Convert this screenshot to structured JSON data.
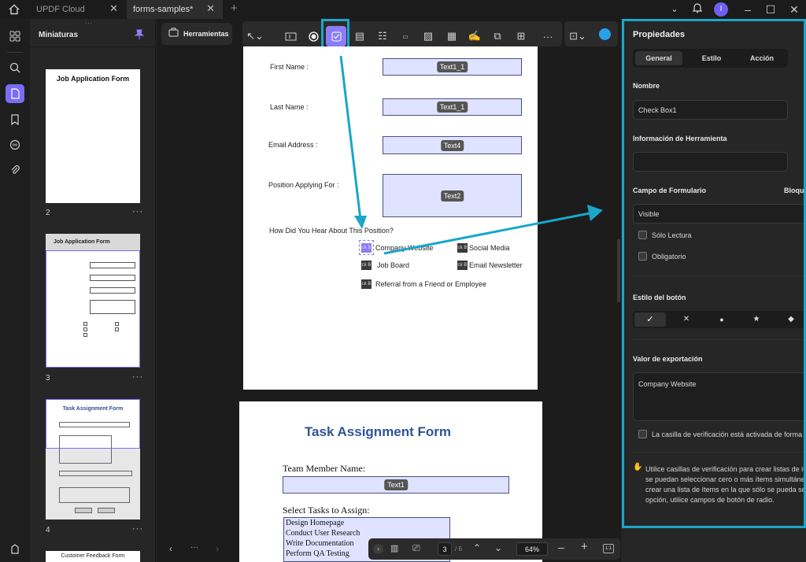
{
  "tabs": [
    {
      "label": "UPDF Cloud"
    },
    {
      "label": "forms-samples*"
    }
  ],
  "thumbnails": {
    "title": "Miniaturas",
    "pages": [
      {
        "number": "2",
        "heading": "Job Application Form"
      },
      {
        "number": "3",
        "heading": "Job Application Form"
      },
      {
        "number": "4",
        "heading": "Task Assignment Form"
      },
      {
        "number": "",
        "heading": "Customer Feedback Form"
      }
    ]
  },
  "toolbar": {
    "tools_label": "Herramientas"
  },
  "page3": {
    "fields": [
      {
        "label": "First Name :",
        "tag": "Text1_1"
      },
      {
        "label": "Last Name :",
        "tag": "Text1_1"
      },
      {
        "label": "Email Address :",
        "tag": "Text4"
      },
      {
        "label": "Position Applying For :",
        "tag": "Text2"
      }
    ],
    "question": "How Did You Hear About This Position?",
    "checkbox_tag": "ck B",
    "options": [
      "Company Website",
      "Social Media",
      "Job Board",
      "Email Newsletter",
      "Referral from a Friend or Employee"
    ]
  },
  "page4": {
    "title": "Task Assignment Form",
    "team_label": "Team Member Name:",
    "team_tag": "Text1",
    "tasks_label": "Select Tasks to Assign:",
    "tasks": [
      "Design Homepage",
      "Conduct User Research",
      "Write Documentation",
      "Perform QA Testing"
    ]
  },
  "bottombar": {
    "page_current": "3",
    "page_total": "/ 6",
    "zoom": "64%",
    "fit": "1:1"
  },
  "properties": {
    "title": "Propiedades",
    "tabs": [
      "General",
      "Estilo",
      "Acción"
    ],
    "name_label": "Nombre",
    "name_value": "Check Box1",
    "tooltip_label": "Información de Herramienta",
    "tooltip_value": "",
    "form_field_label": "Campo de Formulario",
    "lock_label": "Bloqu",
    "visibility_value": "Visible",
    "readonly_label": "Sólo Lectura",
    "required_label": "Obligatorio",
    "button_style_label": "Estilo del botón",
    "button_styles": [
      "✓",
      "✕",
      "●",
      "★",
      "◆"
    ],
    "export_label": "Valor de exportación",
    "export_value": "Company Website",
    "default_checked_label": "La casilla de verificación está activada de forma p",
    "hint_lines": [
      "Utilice casillas de verificación para crear listas de ite",
      "se puedan seleccionar cero o más ítems simultáne",
      "crear una lista de ítems en la que sólo se pueda sele",
      "opción, utilice campos de botón de radio."
    ],
    "accent_color": "#1ba6c9"
  }
}
